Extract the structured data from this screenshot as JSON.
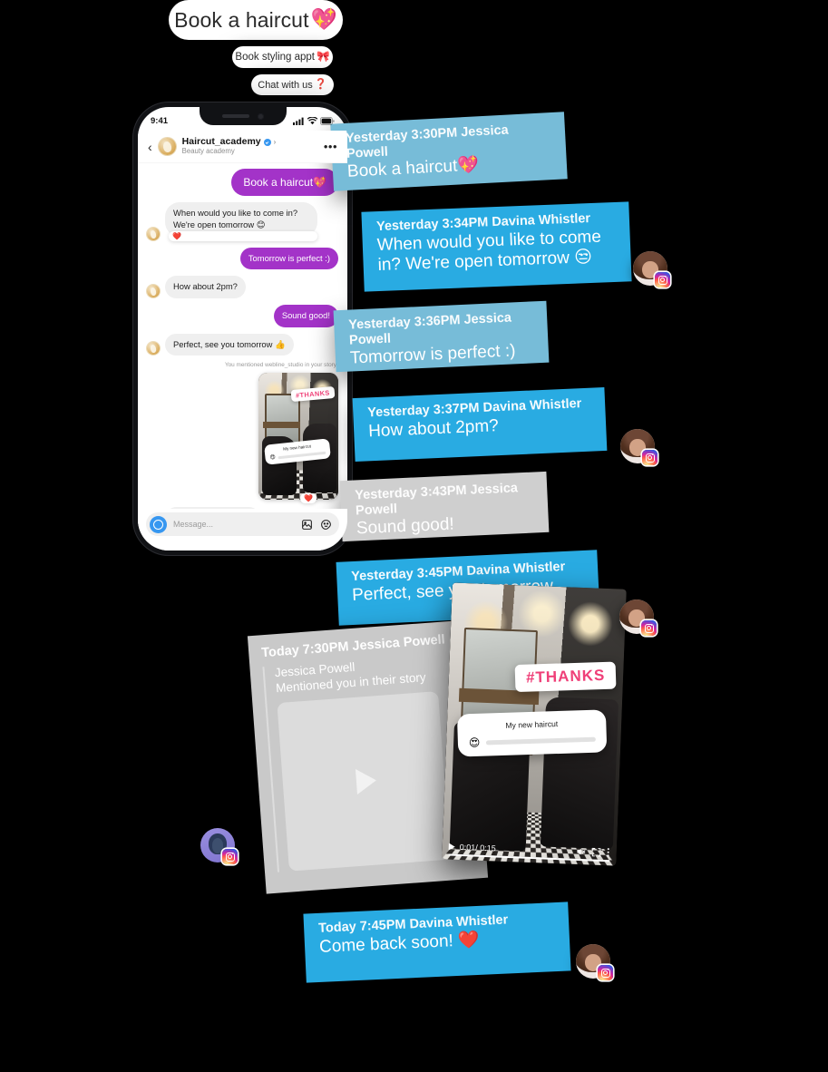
{
  "quick_replies": [
    {
      "label": "Book a haircut",
      "emoji": "💖"
    },
    {
      "label": "Book styling appt",
      "emoji": "🎀"
    },
    {
      "label": "Chat with us ",
      "emoji": "❓"
    }
  ],
  "phone": {
    "status": {
      "time": "9:41",
      "signal": "signal-icon",
      "wifi": "wifi-icon",
      "battery": "battery-icon"
    },
    "header": {
      "back": "‹",
      "account_name": "Haircut_academy",
      "verified_badge": "verified-icon",
      "chevron": "›",
      "subtitle": "Beauty academy",
      "more": "•••"
    },
    "messages": [
      {
        "id": "m1",
        "dir": "out",
        "style": "purple-big",
        "text": "Book a haircut",
        "emoji": "💖"
      },
      {
        "id": "m2",
        "dir": "in",
        "style": "gray",
        "text": "When would you like to come in? We're open tomorrow 😊",
        "reaction": "❤️"
      },
      {
        "id": "m3",
        "dir": "out",
        "style": "purple",
        "text": "Tomorrow is perfect :)"
      },
      {
        "id": "m4",
        "dir": "in",
        "style": "gray",
        "text": "How about 2pm?"
      },
      {
        "id": "m5",
        "dir": "out",
        "style": "purple",
        "text": "Sound good!"
      },
      {
        "id": "m6",
        "dir": "in",
        "style": "gray",
        "text": "Perfect, see you tomorrow 👍"
      }
    ],
    "system_note": "You mentioned webline_studio in your story",
    "story_overlay": {
      "hashtag": "#THANKS",
      "question": "My new haircut",
      "question_emoji": "😍"
    },
    "story_reaction": "❤️",
    "composer": {
      "camera": "camera-icon",
      "placeholder": "Message...",
      "gallery": "gallery-icon",
      "sticker": "sticker-icon"
    }
  },
  "cards": [
    {
      "id": "c1",
      "meta": "Yesterday 3:30PM Jessica Powell",
      "body": "Book a haircut",
      "emoji": "💖",
      "color": "#77bcd8",
      "sender": "Jessica Powell"
    },
    {
      "id": "c2",
      "meta": "Yesterday 3:34PM Davina Whistler",
      "body": "When would you like to come in? We're open tomorrow 😒",
      "color": "#29abe2",
      "sender": "Davina Whistler"
    },
    {
      "id": "c3",
      "meta": "Yesterday 3:36PM Jessica Powell",
      "body": "Tomorrow is perfect :)",
      "color": "#77bcd8",
      "sender": "Jessica Powell"
    },
    {
      "id": "c4",
      "meta": "Yesterday 3:37PM Davina Whistler",
      "body": "How about 2pm?",
      "color": "#29abe2",
      "sender": "Davina Whistler"
    },
    {
      "id": "c5",
      "meta": "Yesterday 3:43PM Jessica Powell",
      "body": "Sound good!",
      "color": "#cfcfcf",
      "sender": "Jessica Powell"
    },
    {
      "id": "c6",
      "meta": "Yesterday 3:45PM Davina Whistler",
      "body": "Perfect, see you tomorrow",
      "color": "#29abe2",
      "sender": "Davina Whistler"
    },
    {
      "id": "c8",
      "meta": "Today 7:45PM Davina Whistler",
      "body": "Come back soon! ❤️",
      "color": "#29abe2",
      "sender": "Davina Whistler"
    }
  ],
  "mention_card": {
    "meta": "Today 7:30PM Jessica Powell",
    "name": "Jessica Powell",
    "subtitle": "Mentioned you in their story",
    "play": "play-icon"
  },
  "video_card": {
    "hashtag": "#THANKS",
    "question": "My new haircut",
    "question_emoji": "😍",
    "time": "0:01/ 0:15",
    "play": "play-icon",
    "mute": "mute-icon",
    "fullscreen": "fullscreen-icon",
    "menu": "kebab-icon"
  },
  "avatars": [
    {
      "id": "av1",
      "person": "Davina Whistler",
      "badge": "instagram-badge"
    },
    {
      "id": "av2",
      "person": "Davina Whistler",
      "badge": "instagram-badge"
    },
    {
      "id": "av3",
      "person": "Davina Whistler",
      "badge": "instagram-badge"
    },
    {
      "id": "av4",
      "person": "Jessica Powell",
      "badge": "instagram-badge"
    },
    {
      "id": "av5",
      "person": "Davina Whistler",
      "badge": "instagram-badge"
    }
  ]
}
